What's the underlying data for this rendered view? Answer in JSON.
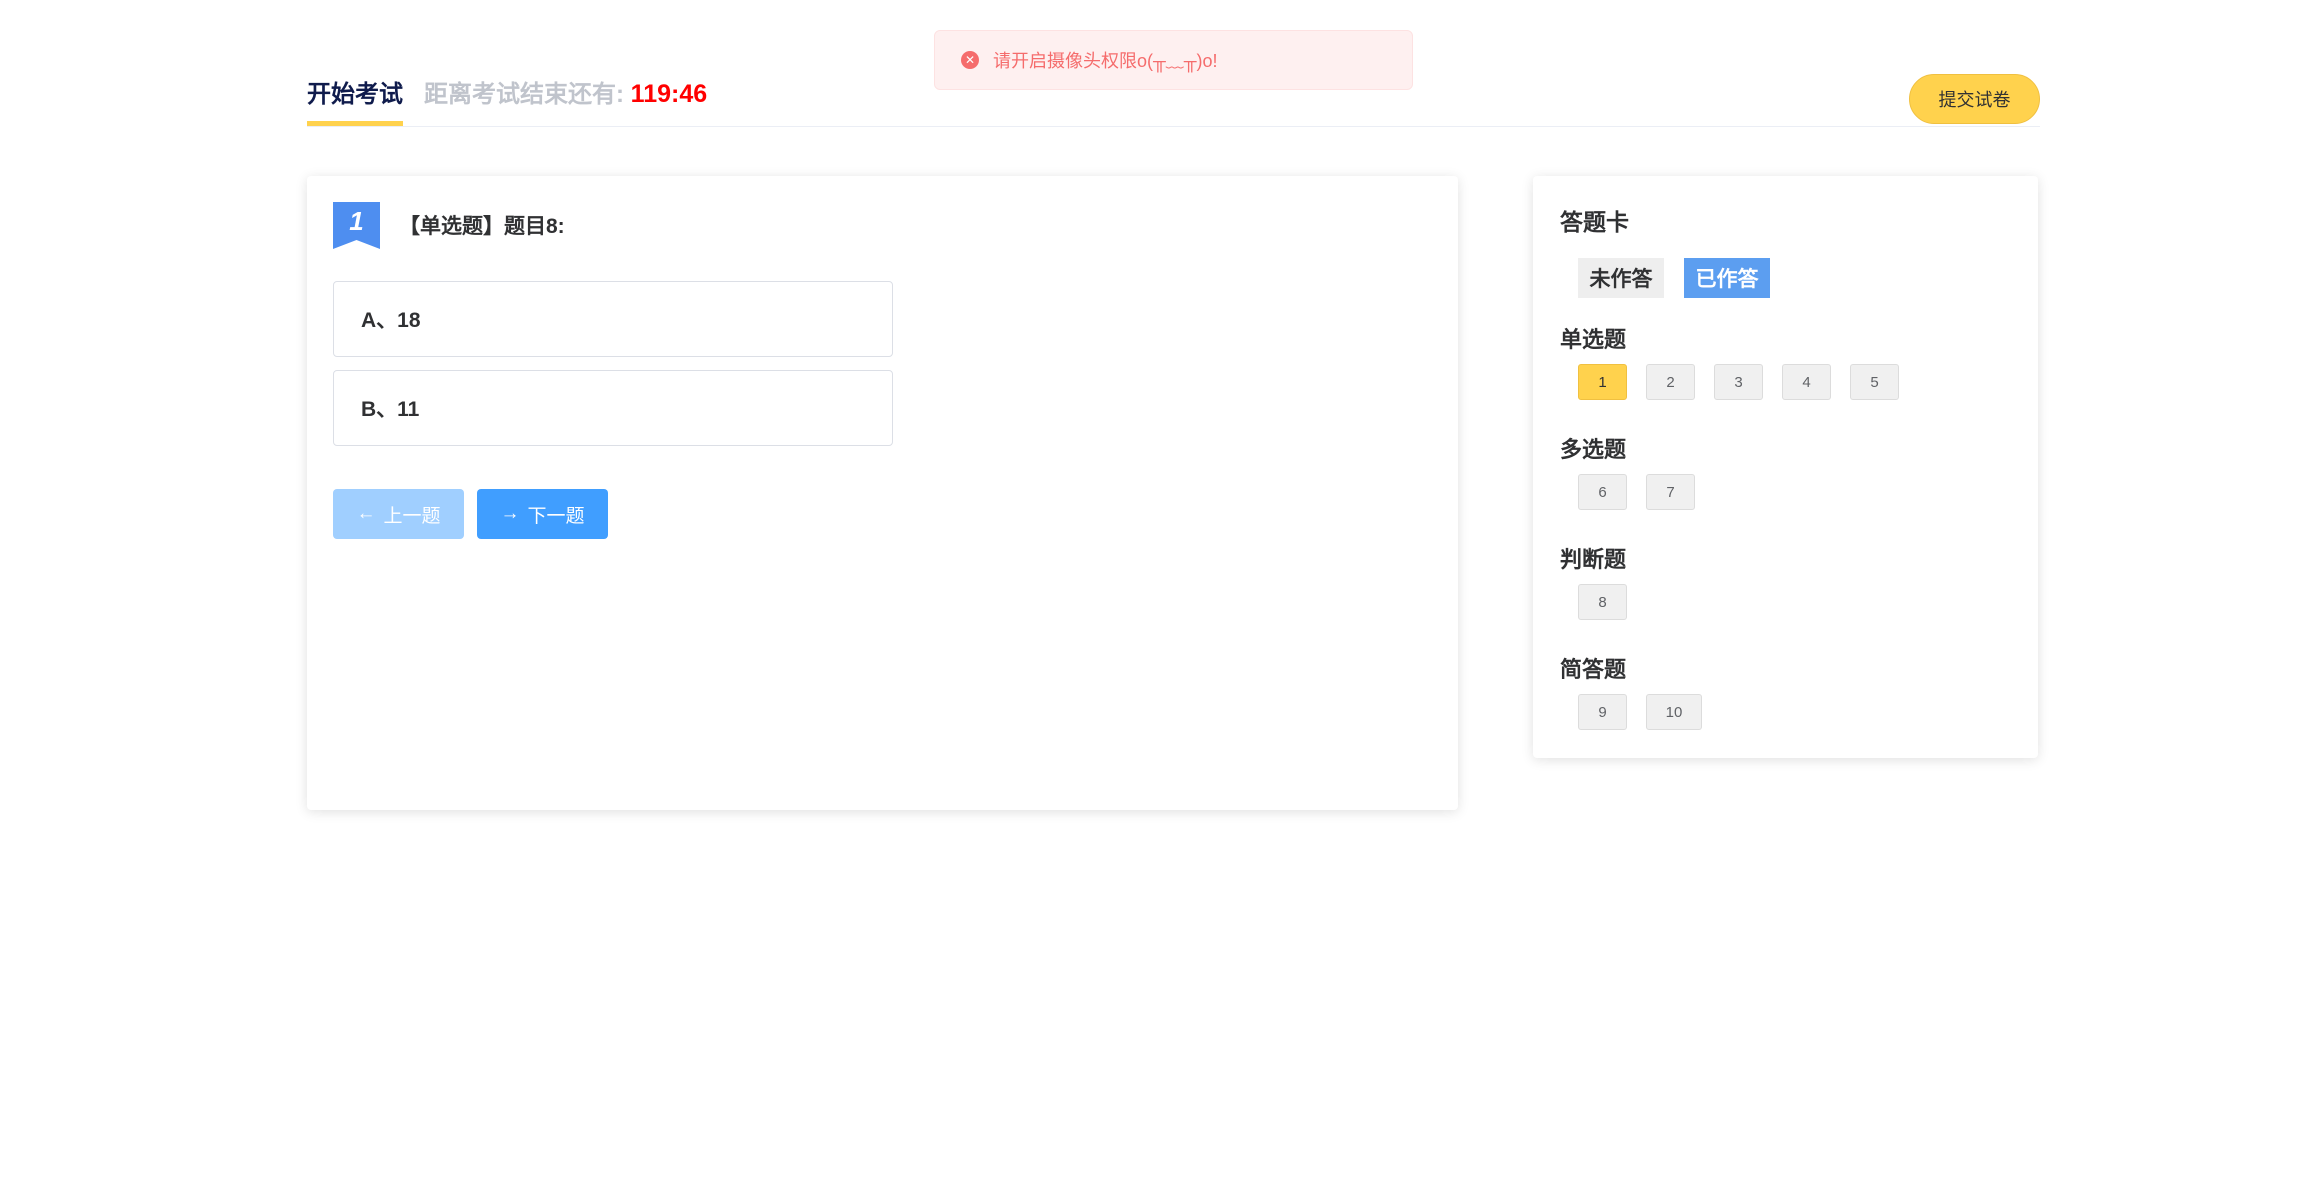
{
  "header": {
    "tab_label": "开始考试",
    "countdown_label": "距离考试结束还有:",
    "countdown_time": "119:46",
    "submit_label": "提交试卷"
  },
  "toast": {
    "message": "请开启摄像头权限o(╥﹏╥)o!",
    "icon": "error-circle-icon",
    "color": "#f56c6c"
  },
  "question": {
    "number": "1",
    "title": "【单选题】题目8:",
    "options": [
      {
        "label": "A、18"
      },
      {
        "label": "B、11"
      }
    ],
    "prev_label": "上一题",
    "next_label": "下一题"
  },
  "answer_sheet": {
    "title": "答题卡",
    "legend_unanswered": "未作答",
    "legend_answered": "已作答",
    "sections": [
      {
        "title": "单选题",
        "items": [
          "1",
          "2",
          "3",
          "4",
          "5"
        ]
      },
      {
        "title": "多选题",
        "items": [
          "6",
          "7"
        ]
      },
      {
        "title": "判断题",
        "items": [
          "8"
        ]
      },
      {
        "title": "简答题",
        "items": [
          "9",
          "10"
        ]
      }
    ],
    "current": "1"
  },
  "colors": {
    "accent_yellow": "#ffd24d",
    "primary_blue": "#409eff",
    "countdown_red": "#ff0000"
  }
}
